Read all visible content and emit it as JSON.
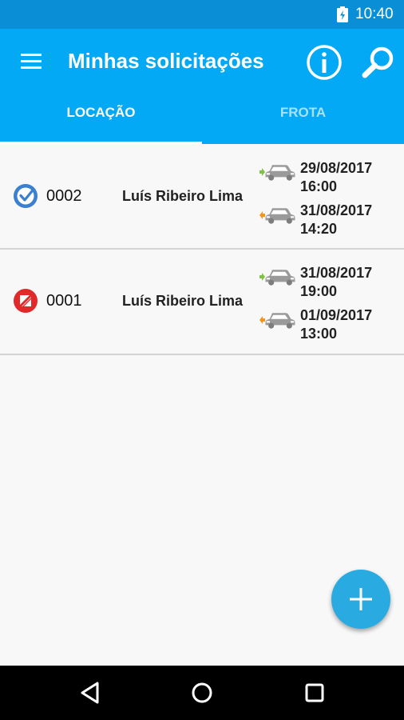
{
  "status_bar": {
    "time": "10:40",
    "icons": [
      "battery-charging-icon"
    ]
  },
  "app_bar": {
    "title": "Minhas solicitações",
    "icons": [
      "menu-icon",
      "info-icon",
      "search-icon"
    ],
    "tabs": [
      {
        "label": "LOCAÇÃO",
        "selected": true
      },
      {
        "label": "FROTA",
        "selected": false
      }
    ]
  },
  "requests": [
    {
      "number": "0002",
      "name": "Luís Ribeiro Lima",
      "status_icon": "check-circle-icon",
      "pickup": {
        "date": "29/08/2017",
        "time": "16:00"
      },
      "return": {
        "date": "31/08/2017",
        "time": "14:20"
      }
    },
    {
      "number": "0001",
      "name": "Luís Ribeiro Lima",
      "status_icon": "cancelled-circle-icon",
      "pickup": {
        "date": "31/08/2017",
        "time": "19:00"
      },
      "return": {
        "date": "01/09/2017",
        "time": "13:00"
      }
    }
  ],
  "fab": {
    "icon": "add-icon"
  },
  "nav_bar": {
    "icons": [
      "back-icon",
      "home-icon",
      "recents-icon"
    ]
  },
  "colors": {
    "status_bar": "#0a8ed6",
    "app_bar": "#03a9f4",
    "fab": "#29abe2",
    "approved": "#3a7fd0",
    "cancelled": "#e02a2a",
    "pickup_arrow": "#7dc242",
    "return_arrow": "#f7941d",
    "car": "#9a9a9a"
  }
}
